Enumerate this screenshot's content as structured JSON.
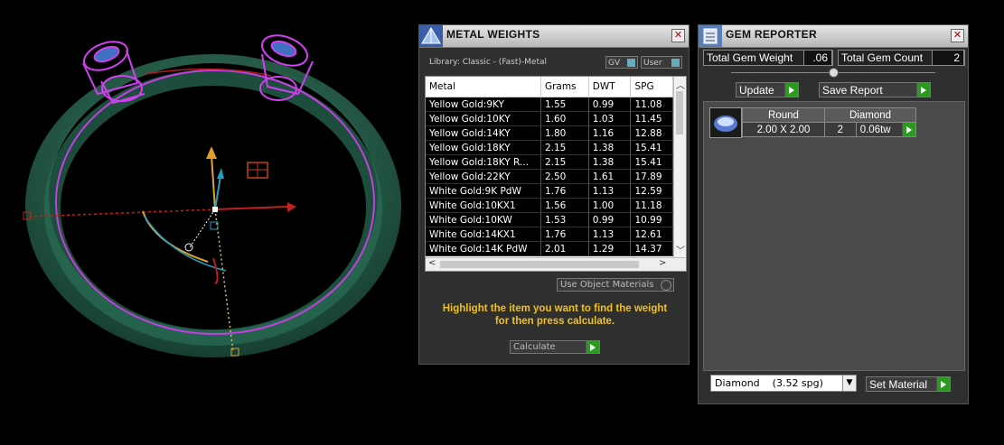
{
  "metal_weights": {
    "title": "METAL WEIGHTS",
    "library": "Library: Classic - (Fast)-Metal",
    "gv_label": "GV",
    "user_label": "User",
    "columns": [
      "Metal",
      "Grams",
      "DWT",
      "SPG"
    ],
    "rows": [
      [
        "Yellow Gold:9KY",
        "1.55",
        "0.99",
        "11.08"
      ],
      [
        "Yellow Gold:10KY",
        "1.60",
        "1.03",
        "11.45"
      ],
      [
        "Yellow Gold:14KY",
        "1.80",
        "1.16",
        "12.88"
      ],
      [
        "Yellow Gold:18KY",
        "2.15",
        "1.38",
        "15.41"
      ],
      [
        "Yellow Gold:18KY R...",
        "2.15",
        "1.38",
        "15.41"
      ],
      [
        "Yellow Gold:22KY",
        "2.50",
        "1.61",
        "17.89"
      ],
      [
        "White Gold:9K PdW",
        "1.76",
        "1.13",
        "12.59"
      ],
      [
        "White Gold:10KX1",
        "1.56",
        "1.00",
        "11.18"
      ],
      [
        "White Gold:10KW",
        "1.53",
        "0.99",
        "10.99"
      ],
      [
        "White Gold:14KX1",
        "1.76",
        "1.13",
        "12.61"
      ],
      [
        "White Gold:14K PdW",
        "2.01",
        "1.29",
        "14.37"
      ]
    ],
    "use_object_materials": "Use Object Materials",
    "hint_line1": "Highlight the item you want to find the weight",
    "hint_line2": "for then press calculate.",
    "calculate_label": "Calculate"
  },
  "gem_reporter": {
    "title": "GEM REPORTER",
    "total_weight_label": "Total Gem Weight",
    "total_weight_value": ".06",
    "total_count_label": "Total Gem Count",
    "total_count_value": "2",
    "update_label": "Update",
    "save_report_label": "Save Report",
    "gem": {
      "shape": "Round",
      "type": "Diamond",
      "size": "2.00 X 2.00",
      "count": "2",
      "weight": "0.06tw"
    },
    "material_select": "Diamond    (3.52 spg)",
    "set_material_label": "Set Material"
  },
  "colors": {
    "ring_green": "#1f5a45",
    "ring_outline": "#c040e0",
    "hint_text": "#f0c020",
    "green_button": "#2c9a22"
  },
  "icons": {
    "metal_title_icon": "pyramid-icon",
    "gem_title_icon": "gem-list-icon",
    "close": "close-icon",
    "play": "play-arrow-icon"
  }
}
